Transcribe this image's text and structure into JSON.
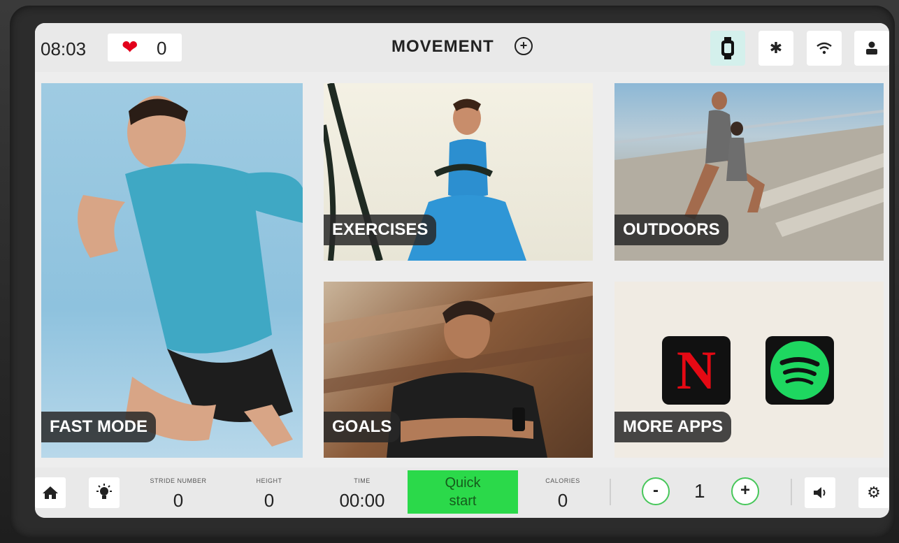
{
  "topbar": {
    "time": "08:03",
    "heart_rate": "0",
    "brand": "MOVEMENT",
    "icons": [
      "watch-icon",
      "bluetooth-icon",
      "wifi-icon",
      "user-icon"
    ]
  },
  "tiles": {
    "fast_mode": "FAST MODE",
    "exercises": "EXERCISES",
    "outdoors": "OUTDOORS",
    "goals": "GOALS",
    "more_apps": "MORE APPS"
  },
  "apps": {
    "netflix_letter": "N"
  },
  "bottombar": {
    "stride_number_label": "STRIDE NUMBER",
    "stride_number_value": "0",
    "height_label": "HEIGHT",
    "height_value": "0",
    "time_label": "TIME",
    "time_value": "00:00",
    "quick_start_line1": "Quick",
    "quick_start_line2": "start",
    "calories_label": "CALORIES",
    "calories_value": "0",
    "minus": "-",
    "level": "1",
    "plus": "+"
  },
  "colors": {
    "quick_start": "#2bd94a",
    "heart": "#e3001b",
    "watch_btn": "#d4f0ec",
    "stepper_ring": "#47c75a"
  }
}
